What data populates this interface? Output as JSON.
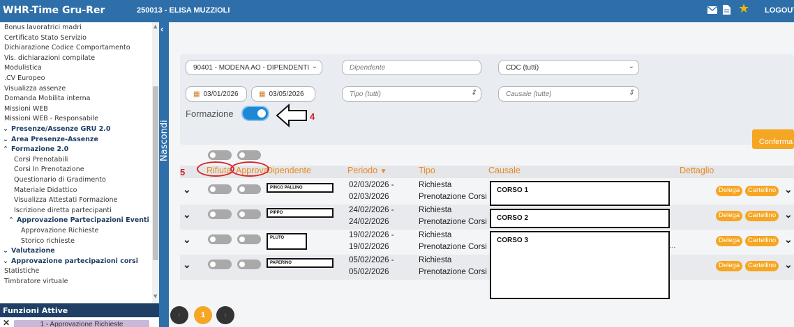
{
  "app_title": "WHR-Time Gru-Rer",
  "user": "250013 - ELISA MUZZIOLI",
  "logout": "LOGOUT",
  "sidebar": {
    "items": [
      {
        "label": "Bonus lavoratrici madri",
        "type": "item"
      },
      {
        "label": "Certificato Stato Servizio",
        "type": "item"
      },
      {
        "label": "Dichiarazione Codice Comportamento",
        "type": "item"
      },
      {
        "label": "Vis. dichiarazioni compilate",
        "type": "item"
      },
      {
        "label": "Modulistica",
        "type": "item"
      },
      {
        "label": ".CV Europeo",
        "type": "item"
      },
      {
        "label": "Visualizza assenze",
        "type": "item"
      },
      {
        "label": "Domanda Mobilita interna",
        "type": "item"
      },
      {
        "label": "Missioni WEB",
        "type": "item"
      },
      {
        "label": "Missioni WEB - Responsabile",
        "type": "item"
      },
      {
        "label": "Presenze/Assenze GRU 2.0",
        "type": "head",
        "chev": "⌄"
      },
      {
        "label": "Area Presenze-Assenze",
        "type": "head",
        "chev": "⌄"
      },
      {
        "label": "Formazione 2.0",
        "type": "head",
        "chev": "⌃"
      },
      {
        "label": "Corsi Prenotabili",
        "type": "sub"
      },
      {
        "label": "Corsi In Prenotazione",
        "type": "sub"
      },
      {
        "label": "Questionario di Gradimento",
        "type": "sub"
      },
      {
        "label": "Materiale Didattico",
        "type": "sub"
      },
      {
        "label": "Visualizza Attestati Formazione",
        "type": "sub"
      },
      {
        "label": "Iscrizione diretta partecipanti",
        "type": "sub"
      },
      {
        "label": "Approvazione Partecipazioni Eventi",
        "type": "subhead",
        "chev": "⌃"
      },
      {
        "label": "Approvazione Richieste",
        "type": "subsub"
      },
      {
        "label": "Storico richieste",
        "type": "subsub"
      },
      {
        "label": "Valutazione",
        "type": "head",
        "chev": "⌄"
      },
      {
        "label": "Approvazione partecipazioni corsi",
        "type": "head",
        "chev": "⌄"
      },
      {
        "label": "Statistiche",
        "type": "item"
      },
      {
        "label": "Timbratore virtuale",
        "type": "item"
      }
    ]
  },
  "funzioni_attive": "Funzioni Attive",
  "active_function": "1 - Approvazione Richieste",
  "nascondi": "Nascondi",
  "filters": {
    "organization": "90401 - MODENA AO - DIPENDENTI",
    "dipendente_placeholder": "Dipendente",
    "cdc": "CDC (tutti)",
    "date_from": "03/01/2026",
    "date_to": "03/05/2026",
    "tipo_placeholder": "Tipo (tutti)",
    "causale_placeholder": "Causale (tutte)",
    "formazione_label": "Formazione",
    "formazione_on": true
  },
  "annotations": {
    "arrow_number": "4",
    "header_number": "5"
  },
  "confirm_button": "Conferma",
  "table": {
    "headers": {
      "rifiuta": "Rifiuta",
      "approva": "Approva",
      "dipendente": "Dipendente",
      "periodo": "Periodo",
      "tipo": "Tipo",
      "causale": "Causale",
      "dettaglio": "Dettaglio"
    },
    "sort_indicator": "▼",
    "rows": [
      {
        "name": "PINCO PALLINO",
        "periodo_from": "02/03/2026 -",
        "periodo_to": "02/03/2026",
        "tipo_1": "Richiesta",
        "tipo_2": "Prenotazione Corsi",
        "causale": "CORSO 1",
        "delega": "Delega",
        "cartellino": "Cartellino"
      },
      {
        "name": "PIPPO",
        "periodo_from": "24/02/2026 -",
        "periodo_to": "24/02/2026",
        "tipo_1": "Richiesta",
        "tipo_2": "Prenotazione Corsi",
        "causale": "CORSO 2",
        "delega": "Delega",
        "cartellino": "Cartellino"
      },
      {
        "name": "PLUTO",
        "periodo_from": "19/02/2026 -",
        "periodo_to": "19/02/2026",
        "tipo_1": "Richiesta",
        "tipo_2": "Prenotazione Corsi",
        "causale": "CORSO 3",
        "delega": "Delega",
        "cartellino": "Cartellino"
      },
      {
        "name": "PAPERINO",
        "periodo_from": "05/02/2026 -",
        "periodo_to": "05/02/2026",
        "tipo_1": "Richiesta",
        "tipo_2": "Prenotazione Corsi",
        "causale": "",
        "delega": "Delega",
        "cartellino": "Cartellino"
      }
    ],
    "ellipsis": "..."
  },
  "pagination": {
    "current": "1"
  },
  "icons": {
    "mail": "mail-icon",
    "document": "document-icon",
    "favorites": "star-icon"
  },
  "colors": {
    "topbar": "#2e6faa",
    "accent": "#f5a623",
    "header_text": "#e8891e",
    "annotation": "#d32020"
  }
}
